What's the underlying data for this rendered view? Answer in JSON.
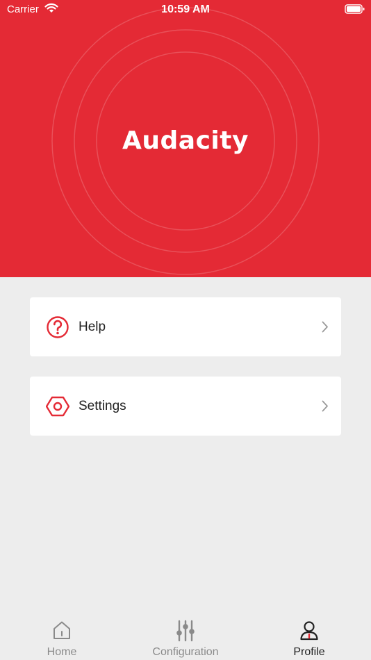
{
  "status_bar": {
    "carrier": "Carrier",
    "time": "10:59 AM"
  },
  "hero": {
    "title": "Audacity",
    "background_color": "#e42a35"
  },
  "menu": [
    {
      "label": "Help",
      "icon": "help-circle-icon"
    },
    {
      "label": "Settings",
      "icon": "settings-hex-icon"
    }
  ],
  "tabbar": {
    "tabs": [
      {
        "label": "Home",
        "icon": "home-icon",
        "active": false
      },
      {
        "label": "Configuration",
        "icon": "sliders-icon",
        "active": false
      },
      {
        "label": "Profile",
        "icon": "profile-icon",
        "active": true
      }
    ]
  },
  "colors": {
    "accent": "#e42a35",
    "background": "#ededed",
    "inactive_tab": "#8a8a8a"
  }
}
